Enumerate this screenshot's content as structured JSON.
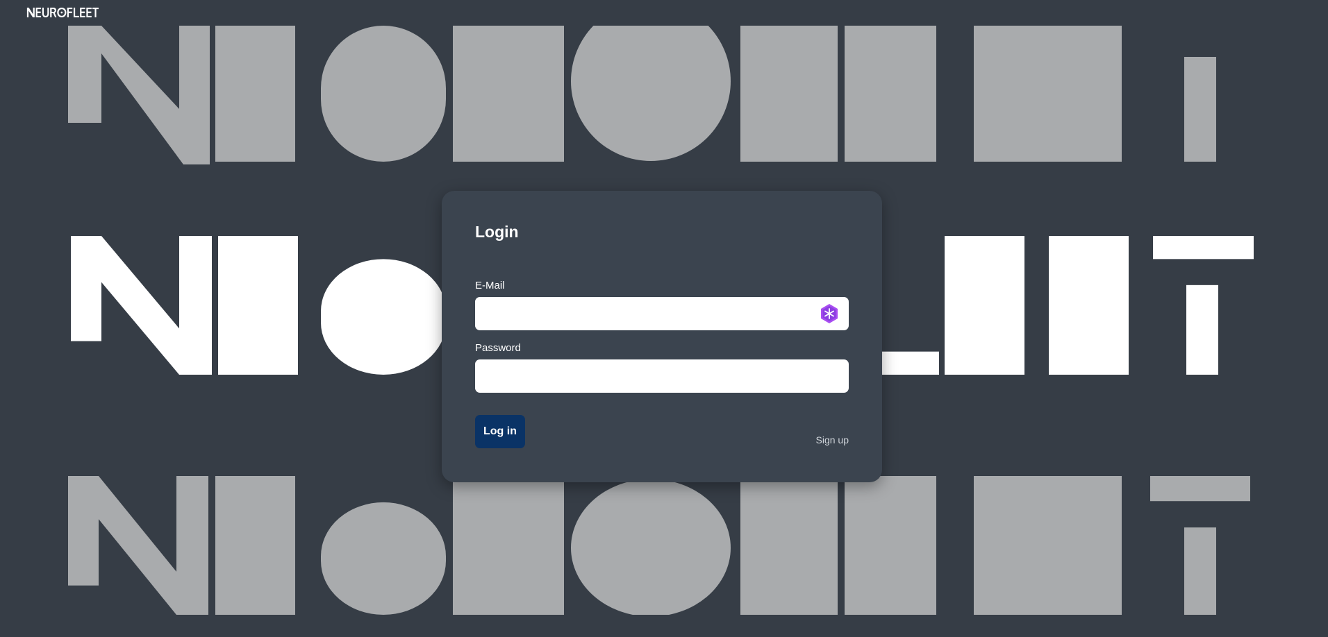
{
  "brand": {
    "name": "NEUROFLEET"
  },
  "login": {
    "title": "Login",
    "email_label": "E-Mail",
    "email_value": "",
    "password_label": "Password",
    "password_value": "",
    "submit_label": "Log in",
    "signup_label": "Sign up"
  },
  "icons": {
    "email_field_extension": "password-manager-hexagon-icon"
  },
  "colors": {
    "background": "#363d46",
    "card": "#3b444f",
    "primary_button": "#0a3366",
    "background_logo_faded": "#a9abad",
    "background_logo_bright": "#ffffff",
    "extension_icon": "#a94df2"
  }
}
